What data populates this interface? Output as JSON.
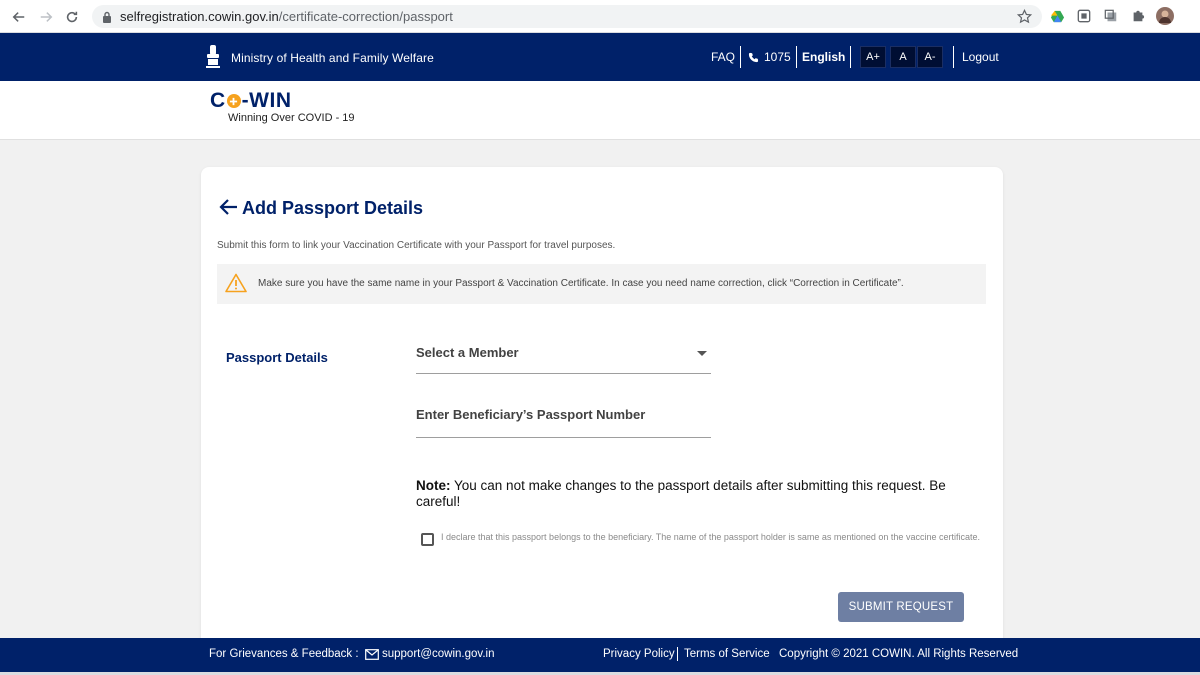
{
  "browser": {
    "url_host": "selfregistration.cowin.gov.in",
    "url_path": "/certificate-correction/passport"
  },
  "header": {
    "ministry": "Ministry of Health and Family Welfare",
    "faq": "FAQ",
    "phone": "1075",
    "language": "English",
    "font_increase": "A+",
    "font_normal": "A",
    "font_decrease": "A-",
    "logout": "Logout"
  },
  "logo": {
    "name_left": "C",
    "name_right": "-WIN",
    "tagline": "Winning Over COVID - 19"
  },
  "form": {
    "title": "Add Passport Details",
    "subtitle": "Submit this form to link your Vaccination Certificate with your Passport for travel purposes.",
    "warning": "Make sure you have the same name in your Passport & Vaccination Certificate. In case you need name correction, click “Correction in Certificate”.",
    "section_label": "Passport Details",
    "member_select_label": "Select a Member",
    "passport_placeholder": "Enter Beneficiary’s Passport Number",
    "note_label": "Note:",
    "note_text": " You can not make changes to the passport details after submitting this request. Be careful!",
    "declaration": "I declare that this passport belongs to the beneficiary. The name of the passport holder is same as mentioned on the vaccine certificate.",
    "submit_label": "SUBMIT REQUEST"
  },
  "footer": {
    "grievance": "For Grievances & Feedback :",
    "email": "support@cowin.gov.in",
    "privacy": "Privacy Policy",
    "terms": "Terms of Service",
    "copyright": "Copyright © 2021 COWIN. All Rights Reserved"
  },
  "colors": {
    "primary": "#002169",
    "accent": "#f6a21e",
    "button": "#6e7fa3"
  }
}
